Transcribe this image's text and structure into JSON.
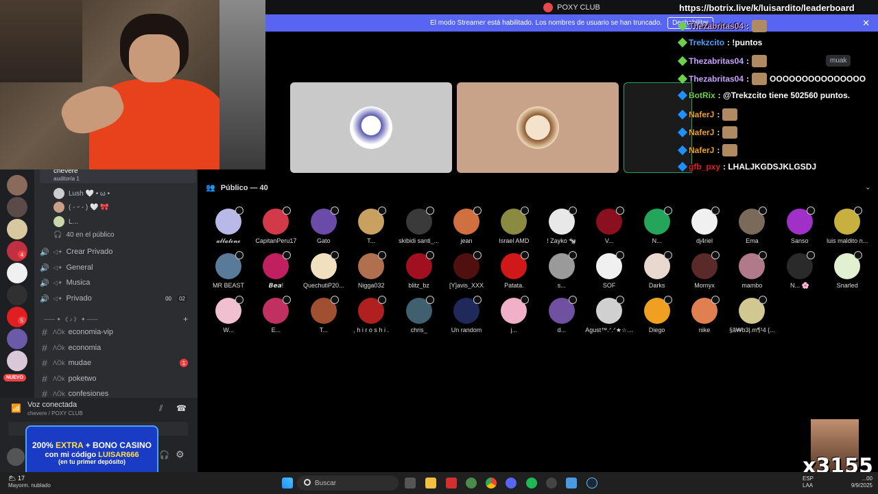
{
  "topbar": {
    "server_title": "POXY CLUB"
  },
  "streamer_banner": {
    "message": "El modo Streamer está habilitado. Los nombres de usuario se han truncado.",
    "disable_label": "Deshabilitar",
    "close_icon": "✕"
  },
  "channels": {
    "active_voice": "chevere",
    "active_voice_sub": "auditoría 1",
    "voice_users": [
      {
        "name": "Lush 🤍 • ω •"
      },
      {
        "name": "( - ᵕ - ) 🤍 🎀"
      },
      {
        "name": "L..."
      }
    ],
    "public_count": "40 en el público",
    "voice_channels": [
      {
        "name": "Crear Privado"
      },
      {
        "name": "General"
      },
      {
        "name": "Musica"
      },
      {
        "name": "Privado",
        "count_a": "00",
        "count_b": "02"
      }
    ],
    "category": "—— ✦ 《 ♪ 》 ✦ ——",
    "text_channels": [
      {
        "name": "economia-vip"
      },
      {
        "name": "economia"
      },
      {
        "name": "mudae",
        "badge": "1"
      },
      {
        "name": "poketwo"
      },
      {
        "name": "confesiones"
      }
    ]
  },
  "rail": {
    "nuevo_label": "NUEVO",
    "badges": [
      "4",
      "5"
    ]
  },
  "voice_panel": {
    "status": "Voz conectada",
    "location": "chevere / POXY CLUB"
  },
  "casino_ad": {
    "line1_a": "200%",
    "line1_b": "EXTRA",
    "line1_c": "+ BONO CASINO",
    "line2_a": "con mi código",
    "line2_b": "LUISAR666",
    "line3": "(en tu primer depósito)"
  },
  "audience": {
    "header": "Público — 40",
    "members": [
      {
        "name": "𝓪𝓵𝓵𝓪𝓽𝓸𝓷𝓮",
        "color": "#b9b9e8"
      },
      {
        "name": "CapitanPeru17",
        "color": "#d23a4a"
      },
      {
        "name": "Gato",
        "color": "#6a4ca8"
      },
      {
        "name": "T...",
        "color": "#c8a060"
      },
      {
        "name": "skibidi santi_...",
        "color": "#3a3a3a"
      },
      {
        "name": "jean",
        "color": "#d07040"
      },
      {
        "name": "Israel AMD",
        "color": "#8a8a40"
      },
      {
        "name": "! Zayko 🐄",
        "color": "#e8e8e8"
      },
      {
        "name": "V...",
        "color": "#8a1020"
      },
      {
        "name": "N...",
        "color": "#23a55a"
      },
      {
        "name": "dj4riel",
        "color": "#f0f0f0"
      },
      {
        "name": "Ema",
        "color": "#7a6a5a"
      },
      {
        "name": "Sanso",
        "color": "#a030c8"
      },
      {
        "name": "luis maldito n...",
        "color": "#c8b040"
      },
      {
        "name": "MR BEAST",
        "color": "#5a7a9a"
      },
      {
        "name": "𝘽𝙚𝙖!",
        "color": "#c02060"
      },
      {
        "name": "QuechutiP20...",
        "color": "#f0e0c0"
      },
      {
        "name": "Nigga032",
        "color": "#b07050"
      },
      {
        "name": "blitz_bz",
        "color": "#a01020"
      },
      {
        "name": "[Y]avis_XXX",
        "color": "#501010"
      },
      {
        "name": "Patata.",
        "color": "#d01818"
      },
      {
        "name": "s...",
        "color": "#9a9a9a"
      },
      {
        "name": "SOF",
        "color": "#f0f0f0"
      },
      {
        "name": "Darks",
        "color": "#e8d8d0"
      },
      {
        "name": "Mornyx",
        "color": "#5a2a2a"
      },
      {
        "name": "mambo",
        "color": "#b07a8a"
      },
      {
        "name": "N... 🌸",
        "color": "#2a2a2a"
      },
      {
        "name": "Snarled",
        "color": "#e0f0d0"
      },
      {
        "name": "W...",
        "color": "#f0c0d0"
      },
      {
        "name": "E...",
        "color": "#c03060"
      },
      {
        "name": "T...",
        "color": "#a05030"
      },
      {
        "name": ", h i r o s h i .",
        "color": "#b02020"
      },
      {
        "name": "chris_",
        "color": "#406070"
      },
      {
        "name": "Un random",
        "color": "#202a5a"
      },
      {
        "name": "j...",
        "color": "#f0b0c8"
      },
      {
        "name": "d...",
        "color": "#7050a0"
      },
      {
        "name": "Agust™.ᐟ.ᐟ★☆ ...",
        "color": "#d0d0d0"
      },
      {
        "name": "Diego",
        "color": "#f0a020"
      },
      {
        "name": "nike",
        "color": "#e08050"
      },
      {
        "name": "§ã₩b3|.m¶¹4 {...",
        "color": "#d0c890"
      }
    ]
  },
  "chat": {
    "url": "https://botrix.live/k/luisardito/leaderboard",
    "lines": [
      {
        "user": "Thezabritas04",
        "text": "",
        "color": "#c8a0ff",
        "gem": "#6cd14a"
      },
      {
        "user": "Trekzcito",
        "text": ": !puntos",
        "color": "#4aa3ff",
        "gem": "#6cd14a"
      },
      {
        "user": "Thezabritas04",
        "text": "",
        "color": "#c8a0ff",
        "gem": "#6cd14a"
      },
      {
        "user": "Thezabritas04",
        "text": "OOOOOOOOOOOOOOO",
        "color": "#c8a0ff",
        "gem": "#6cd14a"
      },
      {
        "user": "BotRix",
        "text": ": @Trekzcito tiene 502560 puntos.",
        "color": "#6cd14a",
        "gem": "#1e90ff"
      },
      {
        "user": "NaferJ",
        "text": "",
        "color": "#f0a020",
        "gem": "#1e90ff"
      },
      {
        "user": "NaferJ",
        "text": "",
        "color": "#f0a020",
        "gem": "#1e90ff"
      },
      {
        "user": "NaferJ",
        "text": "",
        "color": "#f0a020",
        "gem": "#1e90ff"
      },
      {
        "user": "gfb_pxy",
        "text": ": LHALJKGDSJKLGSDJ",
        "color": "#e02020",
        "gem": "#1e90ff"
      }
    ],
    "muak": "muak"
  },
  "counter": {
    "value": "x3155"
  },
  "taskbar": {
    "temp": "17",
    "weather": "Mayorm. nublado",
    "search_placeholder": "Buscar",
    "lang": "ESP",
    "lang_sub": "LAA",
    "time": "...00",
    "date": "9/9/2025"
  }
}
